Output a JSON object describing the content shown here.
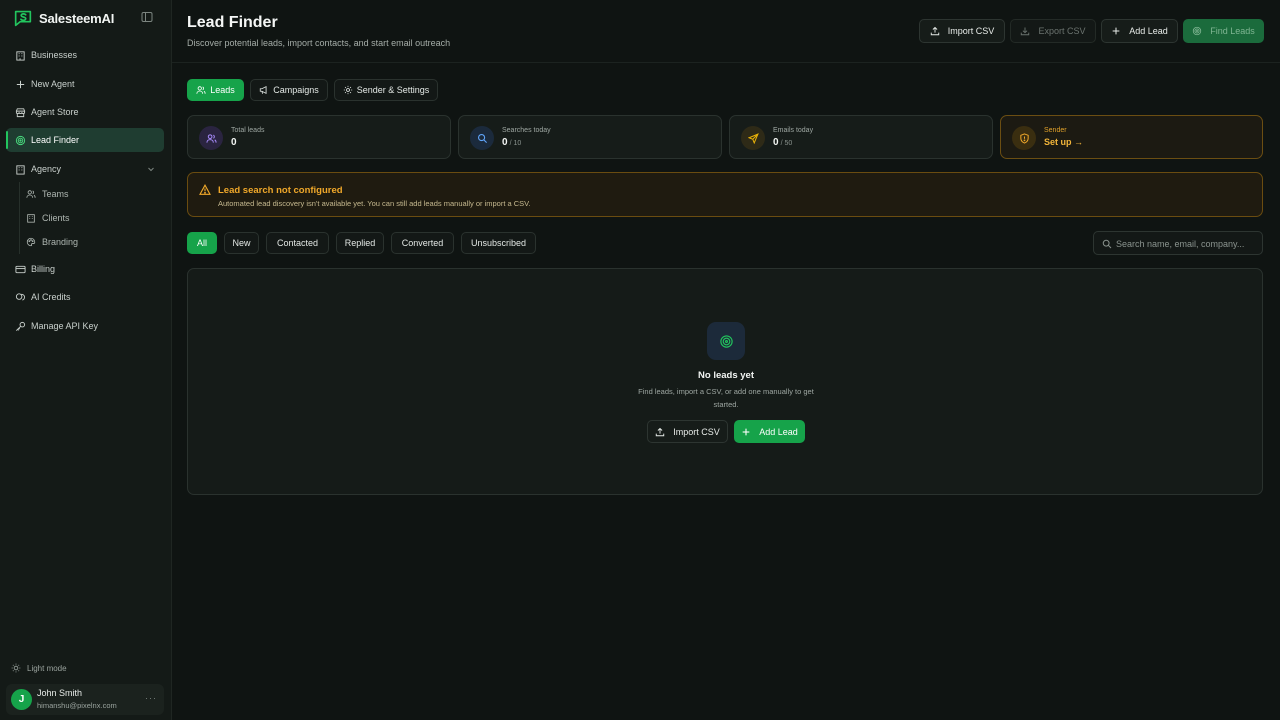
{
  "brand": {
    "name": "SalesteemAI"
  },
  "sidebar": {
    "items": [
      {
        "label": "Businesses"
      },
      {
        "label": "New Agent"
      },
      {
        "label": "Agent Store"
      },
      {
        "label": "Lead Finder"
      },
      {
        "label": "Agency"
      },
      {
        "label": "Billing"
      },
      {
        "label": "AI Credits"
      },
      {
        "label": "Manage API Key"
      }
    ],
    "sub_items": [
      {
        "label": "Teams"
      },
      {
        "label": "Clients"
      },
      {
        "label": "Branding"
      }
    ],
    "light_mode": "Light mode",
    "user": {
      "initial": "J",
      "name": "John Smith",
      "email": "himanshu@pixelnx.com",
      "more": "···"
    }
  },
  "header": {
    "title": "Lead Finder",
    "subtitle": "Discover potential leads, import contacts, and start email outreach",
    "buttons": {
      "import_csv": "Import CSV",
      "export_csv": "Export CSV",
      "add_lead": "Add Lead",
      "find_leads": "Find Leads"
    }
  },
  "tabs": [
    {
      "label": "Leads"
    },
    {
      "label": "Campaigns"
    },
    {
      "label": "Sender & Settings"
    }
  ],
  "stats": {
    "total_leads": {
      "label": "Total leads",
      "value": "0"
    },
    "searches_today": {
      "label": "Searches today",
      "value": "0",
      "suffix": "/ 10"
    },
    "emails_today": {
      "label": "Emails today",
      "value": "0",
      "suffix": "/ 50"
    },
    "sender": {
      "label": "Sender",
      "value": "Set up →"
    }
  },
  "warning": {
    "title": "Lead search not configured",
    "body": "Automated lead discovery isn't available yet. You can still add leads manually or import a CSV."
  },
  "filters": [
    "All",
    "New",
    "Contacted",
    "Replied",
    "Converted",
    "Unsubscribed"
  ],
  "search": {
    "placeholder": "Search name, email, company..."
  },
  "empty_state": {
    "title": "No leads yet",
    "description": "Find leads, import a CSV, or add one manually to get started.",
    "import_csv": "Import CSV",
    "add_lead": "Add Lead"
  },
  "colors": {
    "accent": "#16a34a",
    "warning": "#f0a82a",
    "background": "#0f1412"
  }
}
